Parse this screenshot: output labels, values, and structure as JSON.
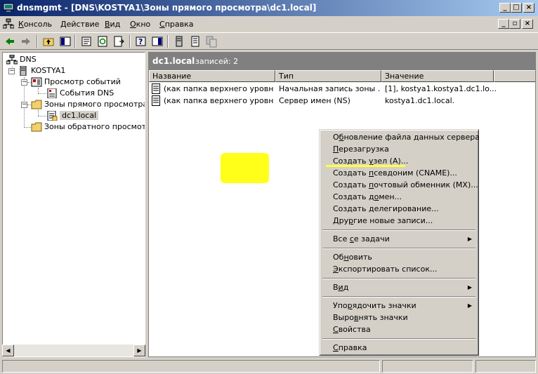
{
  "window": {
    "title": "dnsmgmt - [DNS\\KOSTYA1\\Зоны прямого просмотра\\dc1.local]",
    "min_label": "_",
    "max_label": "□",
    "close_label": "×"
  },
  "menubar": {
    "items": [
      {
        "hot": "К",
        "rest": "онсоль"
      },
      {
        "hot": "Д",
        "rest": "ействие"
      },
      {
        "hot": "В",
        "rest": "ид"
      },
      {
        "hot": "О",
        "rest": "кно"
      },
      {
        "hot": "С",
        "rest": "правка"
      }
    ],
    "mdi_min": "_",
    "mdi_restore": "▫",
    "mdi_close": "×"
  },
  "toolbar": {
    "icons": [
      "back-icon",
      "forward-icon",
      "up-folder-icon",
      "show-hide-tree-icon",
      "properties-icon",
      "refresh-icon",
      "export-list-icon",
      "help-icon",
      "show-hide-action-pane-icon",
      "server-icon",
      "record-icon",
      "copy-icon"
    ]
  },
  "tree": {
    "root": "DNS",
    "server": "KOSTYA1",
    "event_viewer": "Просмотр событий",
    "dns_events": "События DNS",
    "forward_zones": "Зоны прямого просмотра",
    "zone": "dc1.local",
    "reverse_zones": "Зоны обратного просмотра",
    "minus": "−"
  },
  "pane": {
    "zone_name": "dc1.local",
    "record_count": "записей: 2"
  },
  "table": {
    "columns": [
      "Название",
      "Тип",
      "Значение"
    ],
    "rows": [
      [
        "(как папка верхнего уровня)",
        "Начальная запись зоны ...",
        "[1], kostya1.kostya1.dc1.lo..."
      ],
      [
        "(как папка верхнего уровня)",
        "Сервер имен (NS)",
        "kostya1.dc1.local."
      ]
    ]
  },
  "context_menu": {
    "items": [
      {
        "hot": "б",
        "pre": "О",
        "post": "новление файла данных сервера"
      },
      {
        "hot": "П",
        "pre": "",
        "post": "ерезагрузка"
      },
      {
        "hot": "у",
        "pre": "Создать ",
        "post": "зел (A)..."
      },
      {
        "hot": "п",
        "pre": "Создать ",
        "post": "севдоним (CNAME)..."
      },
      {
        "hot": "п",
        "pre": "Создать ",
        "post": "очтовый обменник (MX)..."
      },
      {
        "hot": "о",
        "pre": "Создать д",
        "post": "мен..."
      },
      {
        "hot": "д",
        "pre": "Создать ",
        "post": "елегирование..."
      },
      {
        "hot": "р",
        "pre": "Дру",
        "post": "гие новые записи..."
      },
      {
        "hot": "с",
        "pre": "Все ",
        "post": "е задачи"
      },
      {
        "hot": "н",
        "pre": "Об",
        "post": "овить"
      },
      {
        "hot": "Э",
        "pre": "",
        "post": "кспортировать список..."
      },
      {
        "hot": "и",
        "pre": "В",
        "post": "д"
      },
      {
        "hot": "р",
        "pre": "Упо",
        "post": "ядочить значки"
      },
      {
        "hot": "в",
        "pre": "Выро",
        "post": "нять значки"
      },
      {
        "hot": "С",
        "pre": "",
        "post": "войства"
      },
      {
        "hot": "С",
        "pre": "",
        "post": "правка"
      }
    ],
    "submenu_arrow": "▶"
  },
  "colors": {
    "highlight": "#ffff00",
    "title_start": "#0a246a",
    "title_end": "#a6caf0"
  }
}
